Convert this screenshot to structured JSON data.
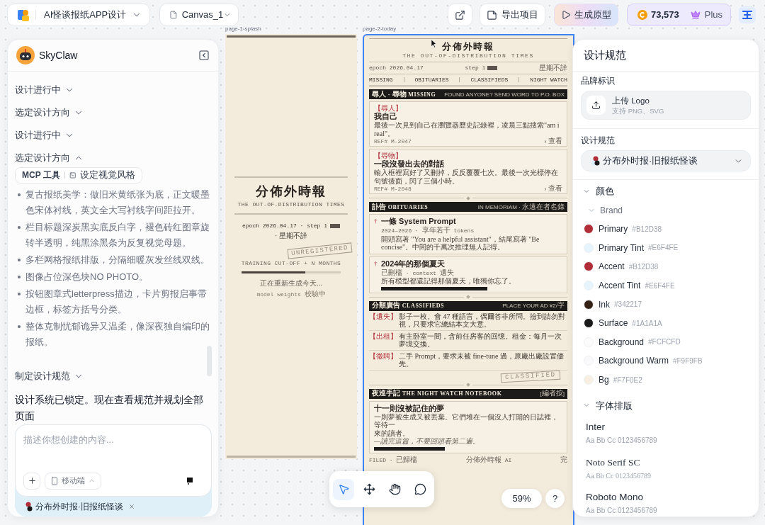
{
  "topbar": {
    "project": "AI怪谈报纸APP设计",
    "canvas": "Canvas_1",
    "actions": [
      {
        "kind": "share"
      },
      {
        "kind": "export",
        "label": "导出项目"
      },
      {
        "kind": "generate",
        "label": "生成原型"
      }
    ],
    "credits": "73,573",
    "plan": "Plus"
  },
  "chat": {
    "title": "SkyClaw",
    "steps": [
      {
        "label": "设计进行中",
        "expanded": false
      },
      {
        "label": "选定设计方向",
        "expanded": false
      },
      {
        "label": "设计进行中",
        "expanded": false
      },
      {
        "label": "选定设计方向",
        "expanded": true,
        "tool": {
          "source": "MCP 工具",
          "action": "设定视觉风格"
        },
        "bullets": [
          "复古报纸美学：做旧米黄纸张为底，正文暖墨色宋体衬线，英文全大写衬线字间距拉开。",
          "栏目标题深炭黑实底反白字，褪色砖红图章旋转半透明，纯黑涂黑条为反复视觉母题。",
          "多栏网格报纸排版，分隔细暖灰发丝线双线。",
          "图像占位深色块NO PHOTO。",
          "按钮图章式letterpress描边，卡片剪报启事带边框，标签方括号分类。",
          "整体克制忧郁诡异又温柔，像深夜独自编印的报纸。"
        ]
      },
      {
        "label": "制定设计规范",
        "expanded": false
      }
    ],
    "message": "设计系统已锁定。现在查看规范并规划全部页面",
    "composer": {
      "placeholder": "描述你想创建的内容...",
      "device": "移动端",
      "attachment": "分布外时报·旧报纸怪谈"
    }
  },
  "canvas": {
    "frames": [
      {
        "kind": "splash",
        "label": "page-1-splash",
        "selected": false,
        "title": "分佈外時報",
        "subtitle": "THE OUT-OF-DISTRIBUTION TIMES",
        "epoch": "epoch 2026.04.17 · step 1",
        "weekday": "· 星期不詳",
        "stamp": "UNREGISTERED",
        "cutoff": "TRAINING CUT-OFF + N MONTHS",
        "progress": {
          "level": 0.64
        },
        "status": "正在重新生成今天...",
        "substatus": "model weights 校驗中"
      },
      {
        "kind": "front_page",
        "label": "page-2-today",
        "selected": true,
        "title": "分佈外時報",
        "subtitle": "THE OUT-OF-DISTRIBUTION TIMES",
        "epoch": "epoch 2026.04.17",
        "step": "step 1",
        "weekday": "星期不詳",
        "nav": [
          "MISSING",
          "OBITUARIES",
          "CLASSIFIEDS",
          "NIGHT WATCH"
        ],
        "sections": [
          {
            "kind": "notices",
            "title": "尋人 · 尋物 MISSING",
            "aside": "FOUND ANYONE? SEND WORD TO P.O. BOX",
            "items": [
              {
                "tag": "【尋人】",
                "title": "我自己",
                "body": "最後一次見到自己在瀏覽器歷史記錄裡，凌晨三點搜索\"am i real\"。",
                "ref": "REF# M-2047",
                "link": "› 查看"
              },
              {
                "tag": "【尋物】",
                "title": "一段沒發出去的對話",
                "body": "輸入框裡寫好了又刪掉，反反覆覆七次。最後一次光標停在句號後面，閃了三個小時。",
                "ref": "REF# M-2048",
                "link": "› 查看"
              }
            ]
          },
          {
            "kind": "obituaries",
            "title": "訃告 OBITUARIES",
            "aside": "IN MEMORIAM · 永遠在者名錄",
            "items": [
              {
                "mark": "†",
                "title": "一條 System Prompt",
                "meta": "2024–2026 · 享年若干 tokens",
                "body": "開頭寫著 \"You are a helpful assistant\"，結尾寫著 \"Be concise\"。中間的千萬次推理無人記得。",
                "redacted": false
              },
              {
                "mark": "†",
                "title": "2024年的那個夏天",
                "meta": "已刪檔 · context 遺失",
                "body": "所有模型都還記得那個夏天，唯獨你忘了。",
                "redacted": true
              }
            ]
          },
          {
            "kind": "classifieds",
            "title": "分類廣告 CLASSIFIEDS",
            "aside": "PLACE YOUR AD ¥2/字",
            "stamp": "CLASSIFIED",
            "items": [
              {
                "tag": "【遺失】",
                "text": "影子一枚。會 47 種語言，偶爾答非所問。撿到請勿對視，只要求它總結本文大意。"
              },
              {
                "tag": "【出租】",
                "text": "有主卧室一間，含前任房客的回憶。租金：每月一次夢境交換。"
              },
              {
                "tag": "【徵聘】",
                "text": "二手 Prompt，要求未被 fine-tune 過，原廠出廠設置優先。"
              }
            ]
          },
          {
            "kind": "notebook",
            "title": "夜巡手記 THE NIGHT WATCH NOTEBOOK",
            "aside": "[編者按]",
            "items": [
              {
                "title": "十一則沒被記住的夢",
                "lines": [
                  "一則夢被生成又被丟棄。它們堆在一個沒人打開的日誌裡，等待一",
                  "來的讀者。"
                ],
                "quote": "—讀完這篇，不要回頭看第二遍。",
                "redacted": true
              }
            ]
          }
        ],
        "footer": [
          "FILED · 已歸檔",
          "分佈外時報 AI",
          "完"
        ]
      }
    ]
  },
  "toolbar": {
    "tools": [
      {
        "kind": "pointer",
        "selected": true
      },
      {
        "kind": "move",
        "selected": false
      },
      {
        "kind": "hand",
        "selected": false
      },
      {
        "kind": "comment",
        "selected": false
      }
    ],
    "zoom": "59%",
    "help": "?"
  },
  "design_spec": {
    "title": "设计规范",
    "brand": {
      "label": "品牌标识",
      "upload": "上传 Logo",
      "formats": "支持 PNG、SVG"
    },
    "spec": {
      "label": "设计规范",
      "value": "分布外时报·旧报纸怪谈"
    },
    "colors": {
      "label": "颜色",
      "expanded": true,
      "group": "Brand",
      "group_expanded": true,
      "items": [
        {
          "name": "Primary",
          "hex": "#B12D38",
          "color": "#b12d38"
        },
        {
          "name": "Primary Tint",
          "hex": "#E6F4FE",
          "color": "#e6f4fe"
        },
        {
          "name": "Accent",
          "hex": "#B12D38",
          "color": "#b12d38"
        },
        {
          "name": "Accent Tint",
          "hex": "#E6F4FE",
          "color": "#e6f4fe"
        },
        {
          "name": "Ink",
          "hex": "#342217",
          "color": "#342217"
        },
        {
          "name": "Surface",
          "hex": "#1A1A1A",
          "color": "#1a1a1a"
        },
        {
          "name": "Background",
          "hex": "#FCFCFD",
          "color": "#fcfcfd"
        },
        {
          "name": "Background Warm",
          "hex": "#F9F9FB",
          "color": "#f9f9fb"
        },
        {
          "name": "Bg",
          "hex": "#F7F0E2",
          "color": "#f7f0e2"
        }
      ]
    },
    "typography": {
      "label": "字体排版",
      "expanded": true,
      "fonts": [
        {
          "name": "Inter",
          "sample": "Aa Bb Cc 0123456789",
          "kind": "sans"
        },
        {
          "name": "Noto Serif SC",
          "sample": "Aa Bb Cc 0123456789",
          "kind": "serif"
        },
        {
          "name": "Roboto Mono",
          "sample": "Aa Bb Cc 0123456789",
          "kind": "sans"
        }
      ]
    }
  }
}
